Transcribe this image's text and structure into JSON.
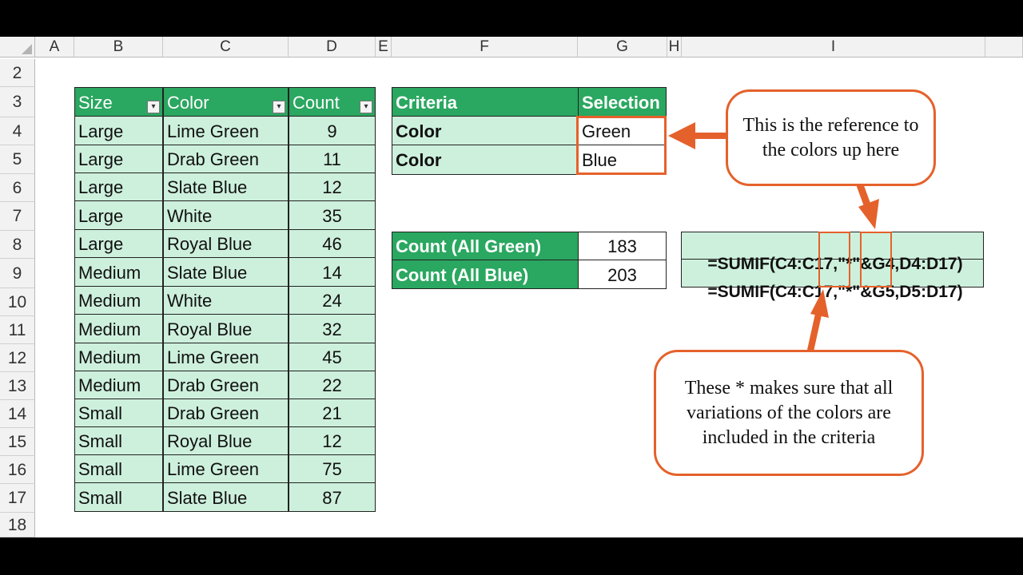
{
  "columns": [
    {
      "name": "corner",
      "label": ""
    },
    {
      "name": "A",
      "label": "A"
    },
    {
      "name": "B",
      "label": "B"
    },
    {
      "name": "C",
      "label": "C"
    },
    {
      "name": "D",
      "label": "D"
    },
    {
      "name": "E",
      "label": "E"
    },
    {
      "name": "F",
      "label": "F"
    },
    {
      "name": "G",
      "label": "G"
    },
    {
      "name": "H",
      "label": "H"
    },
    {
      "name": "I",
      "label": "I"
    }
  ],
  "rows": [
    "2",
    "3",
    "4",
    "5",
    "6",
    "7",
    "8",
    "9",
    "10",
    "11",
    "12",
    "13",
    "14",
    "15",
    "16",
    "17",
    "18"
  ],
  "main_table": {
    "headers": [
      "Size",
      "Color",
      "Count"
    ],
    "rows": [
      [
        "Large",
        "Lime Green",
        "9"
      ],
      [
        "Large",
        "Drab Green",
        "11"
      ],
      [
        "Large",
        "Slate Blue",
        "12"
      ],
      [
        "Large",
        "White",
        "35"
      ],
      [
        "Large",
        "Royal Blue",
        "46"
      ],
      [
        "Medium",
        "Slate Blue",
        "14"
      ],
      [
        "Medium",
        "White",
        "24"
      ],
      [
        "Medium",
        "Royal Blue",
        "32"
      ],
      [
        "Medium",
        "Lime Green",
        "45"
      ],
      [
        "Medium",
        "Drab Green",
        "22"
      ],
      [
        "Small",
        "Drab Green",
        "21"
      ],
      [
        "Small",
        "Royal Blue",
        "12"
      ],
      [
        "Small",
        "Lime Green",
        "75"
      ],
      [
        "Small",
        "Slate Blue",
        "87"
      ]
    ]
  },
  "criteria_table": {
    "headers": [
      "Criteria",
      "Selection"
    ],
    "rows": [
      [
        "Color",
        "Green"
      ],
      [
        "Color",
        "Blue"
      ]
    ]
  },
  "count_table": {
    "rows": [
      [
        "Count (All Green)",
        "183"
      ],
      [
        "Count (All Blue)",
        "203"
      ]
    ]
  },
  "formulas": [
    {
      "a": "=SUMIF(C4:C17,",
      "b": "\"*\"",
      "c": "&",
      "d": "G4,",
      "e": "D4:D17)"
    },
    {
      "a": "=SUMIF(C4:C17,",
      "b": "\"*\"",
      "c": "&",
      "d": "G5,",
      "e": "D5:D17)"
    }
  ],
  "callouts": {
    "top": "This is the reference to the colors up here",
    "bottom": "These * makes sure that all variations of the colors are included in the criteria"
  },
  "colors": {
    "header_green": "#2aa760",
    "light_green": "#cdf0dc",
    "annotation_orange": "#e5612b"
  }
}
